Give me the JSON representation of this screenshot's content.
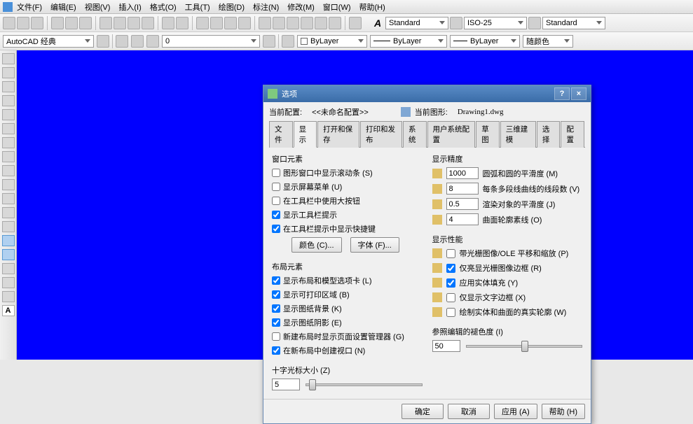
{
  "menu": {
    "items": [
      "文件(F)",
      "编辑(E)",
      "视图(V)",
      "插入(I)",
      "格式(O)",
      "工具(T)",
      "绘图(D)",
      "标注(N)",
      "修改(M)",
      "窗口(W)",
      "帮助(H)"
    ]
  },
  "toolbar1": {
    "style_a": "Standard",
    "style_b": "ISO-25",
    "style_c": "Standard"
  },
  "toolbar2": {
    "workspace": "AutoCAD 经典",
    "layer": "0",
    "bylayer1": "ByLayer",
    "bylayer2": "ByLayer",
    "bylayer3": "ByLayer",
    "color": "随颜色"
  },
  "dialog": {
    "title": "选项",
    "current_profile_lbl": "当前配置:",
    "current_profile_val": "<<未命名配置>>",
    "current_drawing_lbl": "当前图形:",
    "current_drawing_val": "Drawing1.dwg",
    "tabs": [
      "文件",
      "显示",
      "打开和保存",
      "打印和发布",
      "系统",
      "用户系统配置",
      "草图",
      "三维建模",
      "选择",
      "配置"
    ],
    "active_tab": "显示",
    "win_grp": "窗口元素",
    "win_chk": [
      {
        "label": "图形窗口中显示滚动条 (S)",
        "checked": false
      },
      {
        "label": "显示屏幕菜单 (U)",
        "checked": false
      },
      {
        "label": "在工具栏中使用大按钮",
        "checked": false
      },
      {
        "label": "显示工具栏提示",
        "checked": true
      },
      {
        "label": "在工具栏提示中显示快捷键",
        "checked": true
      }
    ],
    "color_btn": "颜色 (C)...",
    "font_btn": "字体 (F)...",
    "layout_grp": "布局元素",
    "layout_chk": [
      {
        "label": "显示布局和模型选项卡 (L)",
        "checked": true
      },
      {
        "label": "显示可打印区域 (B)",
        "checked": true
      },
      {
        "label": "显示图纸背景 (K)",
        "checked": true
      },
      {
        "label": "显示图纸阴影 (E)",
        "checked": true,
        "sub": true
      },
      {
        "label": "新建布局时显示页面设置管理器 (G)",
        "checked": false
      },
      {
        "label": "在新布局中创建视口 (N)",
        "checked": true
      }
    ],
    "prec_grp": "显示精度",
    "prec": [
      {
        "val": "1000",
        "label": "圆弧和圆的平滑度 (M)"
      },
      {
        "val": "8",
        "label": "每条多段线曲线的线段数 (V)"
      },
      {
        "val": "0.5",
        "label": "渲染对象的平滑度 (J)"
      },
      {
        "val": "4",
        "label": "曲面轮廓素线 (O)"
      }
    ],
    "perf_grp": "显示性能",
    "perf_chk": [
      {
        "label": "带光栅图像/OLE 平移和缩放 (P)",
        "checked": false
      },
      {
        "label": "仅亮显光栅图像边框 (R)",
        "checked": true
      },
      {
        "label": "应用实体填充 (Y)",
        "checked": true
      },
      {
        "label": "仅显示文字边框 (X)",
        "checked": false
      },
      {
        "label": "绘制实体和曲面的真实轮廓 (W)",
        "checked": false
      }
    ],
    "cross_lbl": "十字光标大小 (Z)",
    "cross_val": "5",
    "fade_lbl": "参照编辑的褪色度 (I)",
    "fade_val": "50",
    "ok": "确定",
    "cancel": "取消",
    "apply": "应用 (A)",
    "help": "帮助 (H)"
  }
}
